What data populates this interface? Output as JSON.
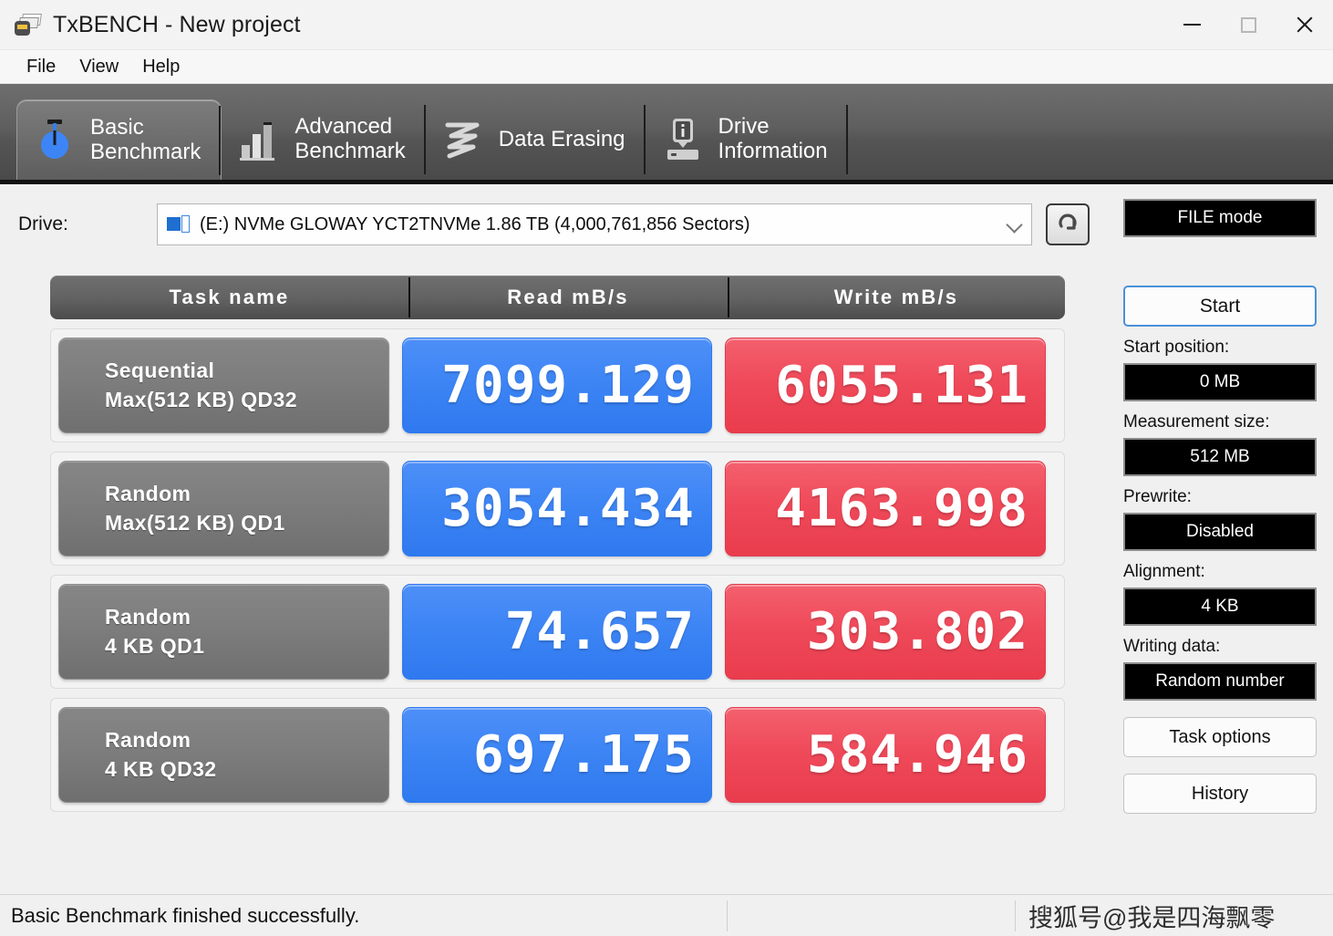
{
  "window": {
    "title": "TxBENCH - New project",
    "app_icon": "device-paper-icon",
    "controls": {
      "minimize": "minimize-icon",
      "maximize": "maximize-icon",
      "close": "close-icon"
    }
  },
  "menubar": {
    "items": [
      {
        "label": "File"
      },
      {
        "label": "View"
      },
      {
        "label": "Help"
      }
    ]
  },
  "tabs": [
    {
      "label": "Basic\nBenchmark",
      "icon": "stopwatch-icon",
      "active": true
    },
    {
      "label": "Advanced\nBenchmark",
      "icon": "bar-chart-icon",
      "active": false
    },
    {
      "label": "Data Erasing",
      "icon": "zigzag-shred-icon",
      "active": false
    },
    {
      "label": "Drive\nInformation",
      "icon": "drive-info-icon",
      "active": false
    }
  ],
  "drive": {
    "label": "Drive:",
    "icon": "drive-icon",
    "selected": "(E:) NVMe GLOWAY YCT2TNVMe  1.86 TB (4,000,761,856 Sectors)",
    "caret": "chevron-down-icon",
    "refresh_icon": "refresh-icon"
  },
  "table": {
    "headers": {
      "task": "Task name",
      "read": "Read mB/s",
      "write": "Write mB/s"
    },
    "rows": [
      {
        "name_line1": "Sequential",
        "name_line2": "Max(512 KB) QD32",
        "read": "7099.129",
        "write": "6055.131"
      },
      {
        "name_line1": "Random",
        "name_line2": "Max(512 KB) QD1",
        "read": "3054.434",
        "write": "4163.998"
      },
      {
        "name_line1": "Random",
        "name_line2": "4 KB QD1",
        "read": "74.657",
        "write": "303.802"
      },
      {
        "name_line1": "Random",
        "name_line2": "4 KB QD32",
        "read": "697.175",
        "write": "584.946"
      }
    ]
  },
  "sidebar": {
    "mode_button": "FILE mode",
    "start_button": "Start",
    "fields": [
      {
        "label": "Start position:",
        "value": "0 MB"
      },
      {
        "label": "Measurement size:",
        "value": "512 MB"
      },
      {
        "label": "Prewrite:",
        "value": "Disabled"
      },
      {
        "label": "Alignment:",
        "value": "4 KB"
      },
      {
        "label": "Writing data:",
        "value": "Random number"
      }
    ],
    "task_options_button": "Task options",
    "history_button": "History"
  },
  "statusbar": {
    "message": "Basic Benchmark finished successfully.",
    "watermark": "搜狐号@我是四海飘零"
  },
  "colors": {
    "read_blue": "#3d85f5",
    "write_red": "#ef4a5a",
    "tab_bar": "#5f5f5f",
    "accent_border": "#4a90d9"
  }
}
